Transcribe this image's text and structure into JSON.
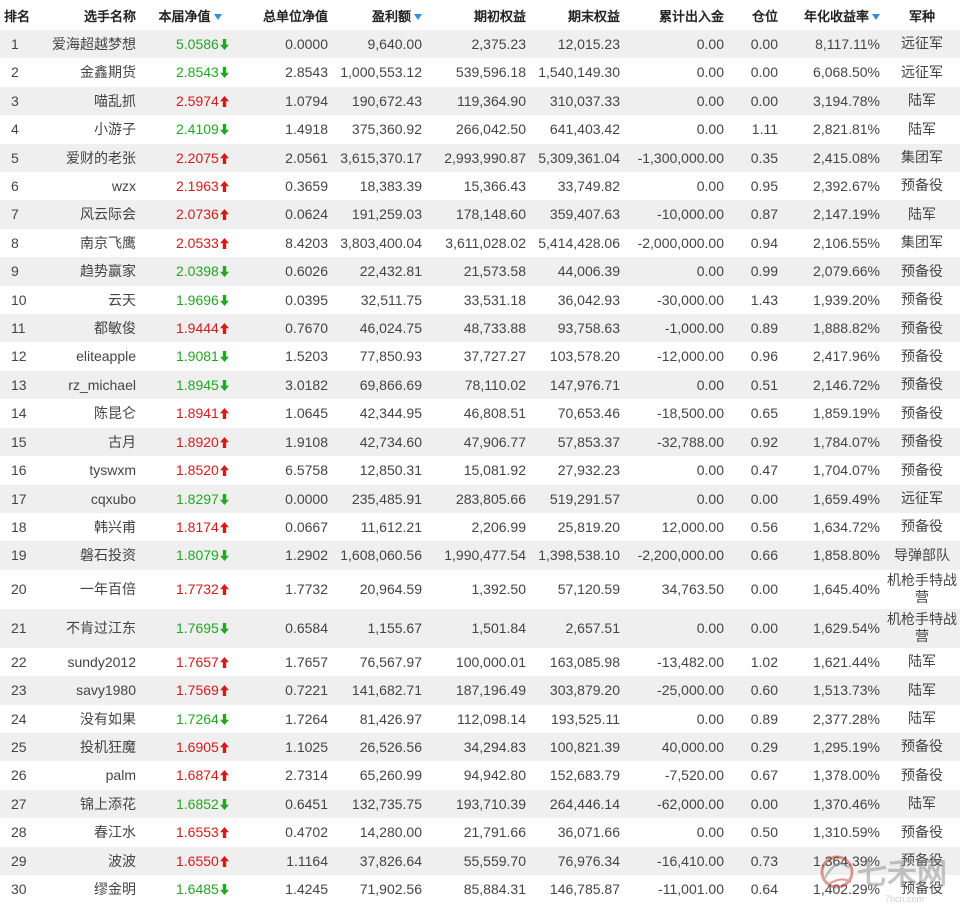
{
  "colors": {
    "up": "#d7191a",
    "down": "#22a722",
    "sort_icon": "#2f8ee0"
  },
  "columns": [
    {
      "key": "rank",
      "label": "排名",
      "sortable": false
    },
    {
      "key": "name",
      "label": "选手名称",
      "sortable": false
    },
    {
      "key": "nav",
      "label": "本届净值",
      "sortable": true
    },
    {
      "key": "unit_nav",
      "label": "总单位净值",
      "sortable": false
    },
    {
      "key": "profit",
      "label": "盈利额",
      "sortable": true
    },
    {
      "key": "begin_equity",
      "label": "期初权益",
      "sortable": false
    },
    {
      "key": "end_equity",
      "label": "期末权益",
      "sortable": false
    },
    {
      "key": "net_flow",
      "label": "累计出入金",
      "sortable": false
    },
    {
      "key": "position",
      "label": "仓位",
      "sortable": false
    },
    {
      "key": "annual_return",
      "label": "年化收益率",
      "sortable": true
    },
    {
      "key": "branch",
      "label": "军种",
      "sortable": false
    }
  ],
  "rows": [
    {
      "rank": "1",
      "name": "爱海超越梦想",
      "nav": {
        "value": "5.0586",
        "dir": "down"
      },
      "unit_nav": "0.0000",
      "profit": "9,640.00",
      "begin_equity": "2,375.23",
      "end_equity": "12,015.23",
      "net_flow": "0.00",
      "position": "0.00",
      "annual_return": "8,117.11%",
      "branch": "远征军"
    },
    {
      "rank": "2",
      "name": "金鑫期货",
      "nav": {
        "value": "2.8543",
        "dir": "down"
      },
      "unit_nav": "2.8543",
      "profit": "1,000,553.12",
      "begin_equity": "539,596.18",
      "end_equity": "1,540,149.30",
      "net_flow": "0.00",
      "position": "0.00",
      "annual_return": "6,068.50%",
      "branch": "远征军"
    },
    {
      "rank": "3",
      "name": "喵乱抓",
      "nav": {
        "value": "2.5974",
        "dir": "up"
      },
      "unit_nav": "1.0794",
      "profit": "190,672.43",
      "begin_equity": "119,364.90",
      "end_equity": "310,037.33",
      "net_flow": "0.00",
      "position": "0.00",
      "annual_return": "3,194.78%",
      "branch": "陆军"
    },
    {
      "rank": "4",
      "name": "小游子",
      "nav": {
        "value": "2.4109",
        "dir": "down"
      },
      "unit_nav": "1.4918",
      "profit": "375,360.92",
      "begin_equity": "266,042.50",
      "end_equity": "641,403.42",
      "net_flow": "0.00",
      "position": "1.11",
      "annual_return": "2,821.81%",
      "branch": "陆军"
    },
    {
      "rank": "5",
      "name": "爱财的老张",
      "nav": {
        "value": "2.2075",
        "dir": "up"
      },
      "unit_nav": "2.0561",
      "profit": "3,615,370.17",
      "begin_equity": "2,993,990.87",
      "end_equity": "5,309,361.04",
      "net_flow": "-1,300,000.00",
      "position": "0.35",
      "annual_return": "2,415.08%",
      "branch": "集团军"
    },
    {
      "rank": "6",
      "name": "wzx",
      "nav": {
        "value": "2.1963",
        "dir": "up"
      },
      "unit_nav": "0.3659",
      "profit": "18,383.39",
      "begin_equity": "15,366.43",
      "end_equity": "33,749.82",
      "net_flow": "0.00",
      "position": "0.95",
      "annual_return": "2,392.67%",
      "branch": "预备役"
    },
    {
      "rank": "7",
      "name": "风云际会",
      "nav": {
        "value": "2.0736",
        "dir": "up"
      },
      "unit_nav": "0.0624",
      "profit": "191,259.03",
      "begin_equity": "178,148.60",
      "end_equity": "359,407.63",
      "net_flow": "-10,000.00",
      "position": "0.87",
      "annual_return": "2,147.19%",
      "branch": "陆军"
    },
    {
      "rank": "8",
      "name": "南京飞鹰",
      "nav": {
        "value": "2.0533",
        "dir": "up"
      },
      "unit_nav": "8.4203",
      "profit": "3,803,400.04",
      "begin_equity": "3,611,028.02",
      "end_equity": "5,414,428.06",
      "net_flow": "-2,000,000.00",
      "position": "0.94",
      "annual_return": "2,106.55%",
      "branch": "集团军"
    },
    {
      "rank": "9",
      "name": "趋势赢家",
      "nav": {
        "value": "2.0398",
        "dir": "down"
      },
      "unit_nav": "0.6026",
      "profit": "22,432.81",
      "begin_equity": "21,573.58",
      "end_equity": "44,006.39",
      "net_flow": "0.00",
      "position": "0.99",
      "annual_return": "2,079.66%",
      "branch": "预备役"
    },
    {
      "rank": "10",
      "name": "云天",
      "nav": {
        "value": "1.9696",
        "dir": "down"
      },
      "unit_nav": "0.0395",
      "profit": "32,511.75",
      "begin_equity": "33,531.18",
      "end_equity": "36,042.93",
      "net_flow": "-30,000.00",
      "position": "1.43",
      "annual_return": "1,939.20%",
      "branch": "预备役"
    },
    {
      "rank": "11",
      "name": "都敏俊",
      "nav": {
        "value": "1.9444",
        "dir": "up"
      },
      "unit_nav": "0.7670",
      "profit": "46,024.75",
      "begin_equity": "48,733.88",
      "end_equity": "93,758.63",
      "net_flow": "-1,000.00",
      "position": "0.89",
      "annual_return": "1,888.82%",
      "branch": "预备役"
    },
    {
      "rank": "12",
      "name": "eliteapple",
      "nav": {
        "value": "1.9081",
        "dir": "down"
      },
      "unit_nav": "1.5203",
      "profit": "77,850.93",
      "begin_equity": "37,727.27",
      "end_equity": "103,578.20",
      "net_flow": "-12,000.00",
      "position": "0.96",
      "annual_return": "2,417.96%",
      "branch": "预备役"
    },
    {
      "rank": "13",
      "name": "rz_michael",
      "nav": {
        "value": "1.8945",
        "dir": "down"
      },
      "unit_nav": "3.0182",
      "profit": "69,866.69",
      "begin_equity": "78,110.02",
      "end_equity": "147,976.71",
      "net_flow": "0.00",
      "position": "0.51",
      "annual_return": "2,146.72%",
      "branch": "预备役"
    },
    {
      "rank": "14",
      "name": "陈昆仑",
      "nav": {
        "value": "1.8941",
        "dir": "up"
      },
      "unit_nav": "1.0645",
      "profit": "42,344.95",
      "begin_equity": "46,808.51",
      "end_equity": "70,653.46",
      "net_flow": "-18,500.00",
      "position": "0.65",
      "annual_return": "1,859.19%",
      "branch": "预备役"
    },
    {
      "rank": "15",
      "name": "古月",
      "nav": {
        "value": "1.8920",
        "dir": "up"
      },
      "unit_nav": "1.9108",
      "profit": "42,734.60",
      "begin_equity": "47,906.77",
      "end_equity": "57,853.37",
      "net_flow": "-32,788.00",
      "position": "0.92",
      "annual_return": "1,784.07%",
      "branch": "预备役"
    },
    {
      "rank": "16",
      "name": "tyswxm",
      "nav": {
        "value": "1.8520",
        "dir": "up"
      },
      "unit_nav": "6.5758",
      "profit": "12,850.31",
      "begin_equity": "15,081.92",
      "end_equity": "27,932.23",
      "net_flow": "0.00",
      "position": "0.47",
      "annual_return": "1,704.07%",
      "branch": "预备役"
    },
    {
      "rank": "17",
      "name": "cqxubo",
      "nav": {
        "value": "1.8297",
        "dir": "down"
      },
      "unit_nav": "0.0000",
      "profit": "235,485.91",
      "begin_equity": "283,805.66",
      "end_equity": "519,291.57",
      "net_flow": "0.00",
      "position": "0.00",
      "annual_return": "1,659.49%",
      "branch": "远征军"
    },
    {
      "rank": "18",
      "name": "韩兴甫",
      "nav": {
        "value": "1.8174",
        "dir": "up"
      },
      "unit_nav": "0.0667",
      "profit": "11,612.21",
      "begin_equity": "2,206.99",
      "end_equity": "25,819.20",
      "net_flow": "12,000.00",
      "position": "0.56",
      "annual_return": "1,634.72%",
      "branch": "预备役"
    },
    {
      "rank": "19",
      "name": "磐石投资",
      "nav": {
        "value": "1.8079",
        "dir": "down"
      },
      "unit_nav": "1.2902",
      "profit": "1,608,060.56",
      "begin_equity": "1,990,477.54",
      "end_equity": "1,398,538.10",
      "net_flow": "-2,200,000.00",
      "position": "0.66",
      "annual_return": "1,858.80%",
      "branch": "导弹部队"
    },
    {
      "rank": "20",
      "name": "一年百倍",
      "nav": {
        "value": "1.7732",
        "dir": "up"
      },
      "unit_nav": "1.7732",
      "profit": "20,964.59",
      "begin_equity": "1,392.50",
      "end_equity": "57,120.59",
      "net_flow": "34,763.50",
      "position": "0.00",
      "annual_return": "1,645.40%",
      "branch": "机枪手特战营"
    },
    {
      "rank": "21",
      "name": "不肯过江东",
      "nav": {
        "value": "1.7695",
        "dir": "down"
      },
      "unit_nav": "0.6584",
      "profit": "1,155.67",
      "begin_equity": "1,501.84",
      "end_equity": "2,657.51",
      "net_flow": "0.00",
      "position": "0.00",
      "annual_return": "1,629.54%",
      "branch": "机枪手特战营"
    },
    {
      "rank": "22",
      "name": "sundy2012",
      "nav": {
        "value": "1.7657",
        "dir": "up"
      },
      "unit_nav": "1.7657",
      "profit": "76,567.97",
      "begin_equity": "100,000.01",
      "end_equity": "163,085.98",
      "net_flow": "-13,482.00",
      "position": "1.02",
      "annual_return": "1,621.44%",
      "branch": "陆军"
    },
    {
      "rank": "23",
      "name": "savy1980",
      "nav": {
        "value": "1.7569",
        "dir": "up"
      },
      "unit_nav": "0.7221",
      "profit": "141,682.71",
      "begin_equity": "187,196.49",
      "end_equity": "303,879.20",
      "net_flow": "-25,000.00",
      "position": "0.60",
      "annual_return": "1,513.73%",
      "branch": "陆军"
    },
    {
      "rank": "24",
      "name": "没有如果",
      "nav": {
        "value": "1.7264",
        "dir": "down"
      },
      "unit_nav": "1.7264",
      "profit": "81,426.97",
      "begin_equity": "112,098.14",
      "end_equity": "193,525.11",
      "net_flow": "0.00",
      "position": "0.89",
      "annual_return": "2,377.28%",
      "branch": "陆军"
    },
    {
      "rank": "25",
      "name": "投机狂魔",
      "nav": {
        "value": "1.6905",
        "dir": "up"
      },
      "unit_nav": "1.1025",
      "profit": "26,526.56",
      "begin_equity": "34,294.83",
      "end_equity": "100,821.39",
      "net_flow": "40,000.00",
      "position": "0.29",
      "annual_return": "1,295.19%",
      "branch": "预备役"
    },
    {
      "rank": "26",
      "name": "palm",
      "nav": {
        "value": "1.6874",
        "dir": "up"
      },
      "unit_nav": "2.7314",
      "profit": "65,260.99",
      "begin_equity": "94,942.80",
      "end_equity": "152,683.79",
      "net_flow": "-7,520.00",
      "position": "0.67",
      "annual_return": "1,378.00%",
      "branch": "预备役"
    },
    {
      "rank": "27",
      "name": "锦上添花",
      "nav": {
        "value": "1.6852",
        "dir": "down"
      },
      "unit_nav": "0.6451",
      "profit": "132,735.75",
      "begin_equity": "193,710.39",
      "end_equity": "264,446.14",
      "net_flow": "-62,000.00",
      "position": "0.00",
      "annual_return": "1,370.46%",
      "branch": "陆军"
    },
    {
      "rank": "28",
      "name": "春江水",
      "nav": {
        "value": "1.6553",
        "dir": "up"
      },
      "unit_nav": "0.4702",
      "profit": "14,280.00",
      "begin_equity": "21,791.66",
      "end_equity": "36,071.66",
      "net_flow": "0.00",
      "position": "0.50",
      "annual_return": "1,310.59%",
      "branch": "预备役"
    },
    {
      "rank": "29",
      "name": "波波",
      "nav": {
        "value": "1.6550",
        "dir": "up"
      },
      "unit_nav": "1.1164",
      "profit": "37,826.64",
      "begin_equity": "55,559.70",
      "end_equity": "76,976.34",
      "net_flow": "-16,410.00",
      "position": "0.73",
      "annual_return": "1,364.39%",
      "branch": "预备役"
    },
    {
      "rank": "30",
      "name": "缪金明",
      "nav": {
        "value": "1.6485",
        "dir": "down"
      },
      "unit_nav": "1.4245",
      "profit": "71,902.56",
      "begin_equity": "85,884.31",
      "end_equity": "146,785.87",
      "net_flow": "-11,001.00",
      "position": "0.64",
      "annual_return": "1,402.29%",
      "branch": "预备役"
    }
  ],
  "watermark": {
    "text": "七禾网",
    "url": "7hcn.com"
  }
}
